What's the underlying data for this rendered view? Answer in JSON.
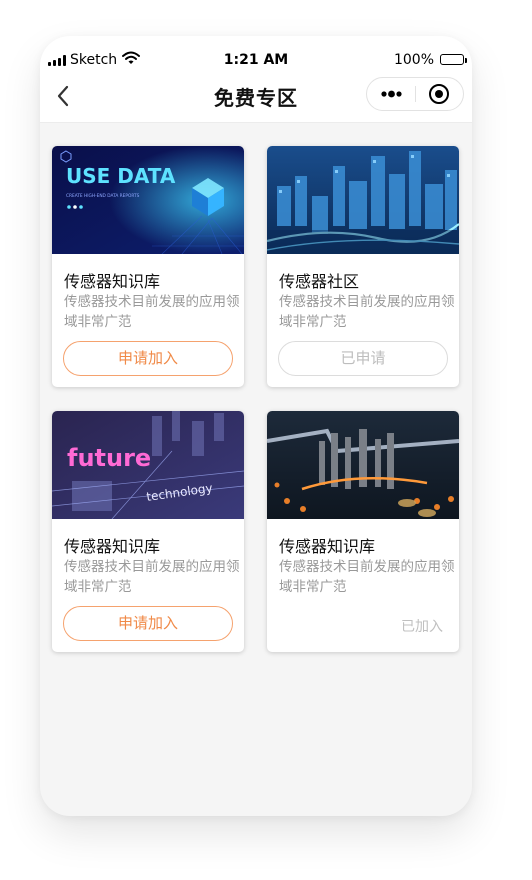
{
  "status_bar": {
    "carrier": "Sketch",
    "time": "1:21 AM",
    "battery": "100%"
  },
  "nav": {
    "title": "免费专区"
  },
  "cards": [
    {
      "image_text": "USE DATA",
      "image_subtext": "CREATE HIGH-END DATA REPORTS",
      "title": "传感器知识库",
      "desc": "传感器技术目前发展的应用领域非常广范",
      "action": "申请加入",
      "action_state": "apply"
    },
    {
      "title": "传感器社区",
      "desc": "传感器技术目前发展的应用领域非常广范",
      "action": "已申请",
      "action_state": "applied"
    },
    {
      "image_text": "future",
      "image_subtext": "technology",
      "title": "传感器知识库",
      "desc": "传感器技术目前发展的应用领域非常广范",
      "action": "申请加入",
      "action_state": "apply"
    },
    {
      "title": "传感器知识库",
      "desc": "传感器技术目前发展的应用领域非常广范",
      "action": "已加入",
      "action_state": "joined"
    }
  ],
  "colors": {
    "accent": "#f08a48",
    "accent_border": "#f5a26e",
    "muted": "#999999",
    "page_bg": "#f5f5f5"
  }
}
